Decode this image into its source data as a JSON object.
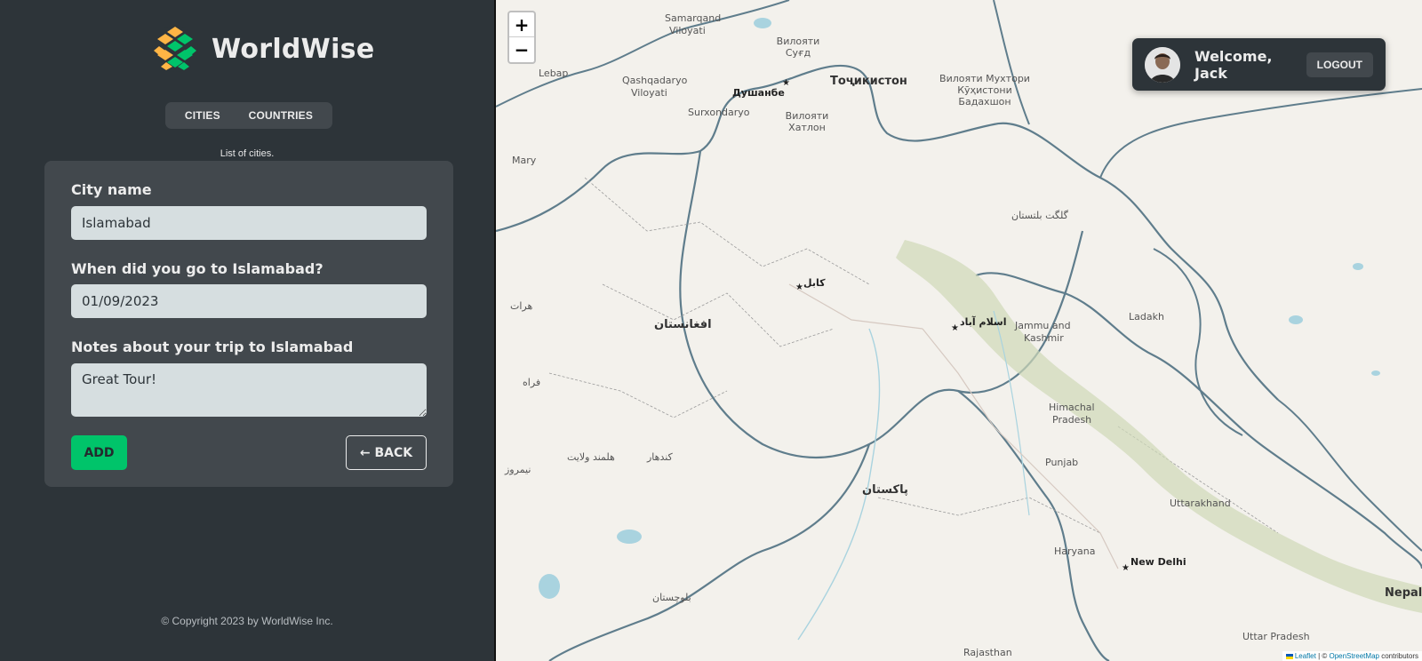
{
  "app": {
    "name": "WorldWise"
  },
  "nav": {
    "tabs": [
      {
        "label": "CITIES"
      },
      {
        "label": "COUNTRIES"
      }
    ]
  },
  "list_caption": "List of cities.",
  "form": {
    "city_label": "City name",
    "city_value": "Islamabad",
    "date_label": "When did you go to Islamabad?",
    "date_value": "01/09/2023",
    "notes_label": "Notes about your trip to Islamabad",
    "notes_value": "Great Tour!",
    "add_label": "ADD",
    "back_label": "← BACK"
  },
  "footer": {
    "copyright": "© Copyright 2023 by WorldWise Inc."
  },
  "user": {
    "welcome": "Welcome, Jack",
    "logout_label": "LOGOUT"
  },
  "map": {
    "zoom_in": "+",
    "zoom_out": "−",
    "labels": {
      "tajikistan": "Тоҷикистон",
      "dushanbe": "Душанбе",
      "afghanistan": "افغانستان",
      "kabul": "کابل",
      "islamabad": "اسلام آباد",
      "pakistan": "پاکستان",
      "jammu": "Jammu and",
      "kashmir": "Kashmir",
      "ladakh": "Ladakh",
      "himachal": "Himachal",
      "pradesh": "Pradesh",
      "punjab": "Punjab",
      "uttarakhand": "Uttarakhand",
      "haryana": "Haryana",
      "new_delhi": "New Delhi",
      "nepal": "Nepal",
      "uttar_pradesh": "Uttar Pradesh",
      "rajasthan": "Rajasthan",
      "mary": "Mary",
      "lebap": "Lebap",
      "samarqand": "Samarqand",
      "viloyati": "Viloyati",
      "qashqadaryo": "Qashqadaryo",
      "surxondaryo": "Surxondaryo",
      "sugd": "Вилояти Суғд",
      "khatlon": "Вилояти Хатлон",
      "badakhshon": "Вилояти Мухтори Кӯҳистони Бадахшон",
      "gilgit": "گلگت بلتستان",
      "balochistan": "بلوچستان",
      "herat": "هرات",
      "nimruz": "نیمروز",
      "kandahar": "کندهار",
      "helmand": "هلمند ولایت",
      "farah": "فراه"
    },
    "attribution": {
      "leaflet": "Leaflet",
      "sep": " | © ",
      "osm": "OpenStreetMap",
      "contrib": " contributors"
    }
  },
  "colors": {
    "dark_bg": "#2d3439",
    "panel_bg": "#42484d",
    "brand_green": "#00c46a",
    "brand_yellow": "#ffb545",
    "input_bg": "#d6dee0"
  }
}
